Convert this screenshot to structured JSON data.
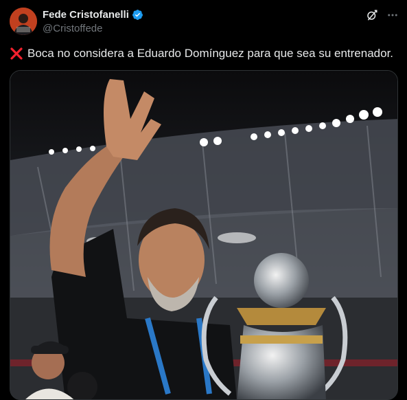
{
  "author": {
    "display_name": "Fede Cristofanelli",
    "handle": "@Cristoffede",
    "avatar_icon": "avatar-photo",
    "verified_icon": "verified-badge-icon",
    "verified_color": "#1d9bf0"
  },
  "actions": {
    "grok_icon": "grok-icon",
    "more_icon": "more-options-icon"
  },
  "tweet": {
    "prefix_icon": "red-cross-mark-icon",
    "text": "Boca no considera a Eduardo Domínguez para que sea su entrenador."
  },
  "media": {
    "type": "photo",
    "icon": "stadium-photo"
  },
  "colors": {
    "background": "#000000",
    "text": "#e7e9ea",
    "muted": "#71767b",
    "cross": "#f4212e"
  }
}
